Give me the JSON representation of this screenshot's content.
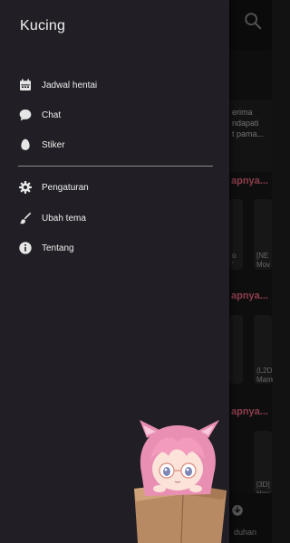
{
  "app": {
    "title": "Kucing"
  },
  "drawer": {
    "primary_items": [
      {
        "label": "Jadwal hentai",
        "icon": "calendar-icon"
      },
      {
        "label": "Chat",
        "icon": "chat-bubble-icon"
      },
      {
        "label": "Stiker",
        "icon": "egg-icon"
      }
    ],
    "secondary_items": [
      {
        "label": "Pengaturan",
        "icon": "gear-icon"
      },
      {
        "label": "Ubah tema",
        "icon": "brush-icon"
      },
      {
        "label": "Tentang",
        "icon": "info-icon"
      }
    ]
  },
  "background": {
    "hero_snippet": "erima\nndapati\nt pama...",
    "section_labels": [
      "apnya...",
      "apnya...",
      "apnya..."
    ],
    "card_snippets": [
      "o\n’",
      "[NE\nMov",
      "(L2D\nMam",
      "[3D]\nHou"
    ],
    "bottom_label": "duhan"
  },
  "colors": {
    "drawer_bg": "#211f25",
    "accent_pink": "#ff6f8a",
    "text": "#eeeeee"
  }
}
